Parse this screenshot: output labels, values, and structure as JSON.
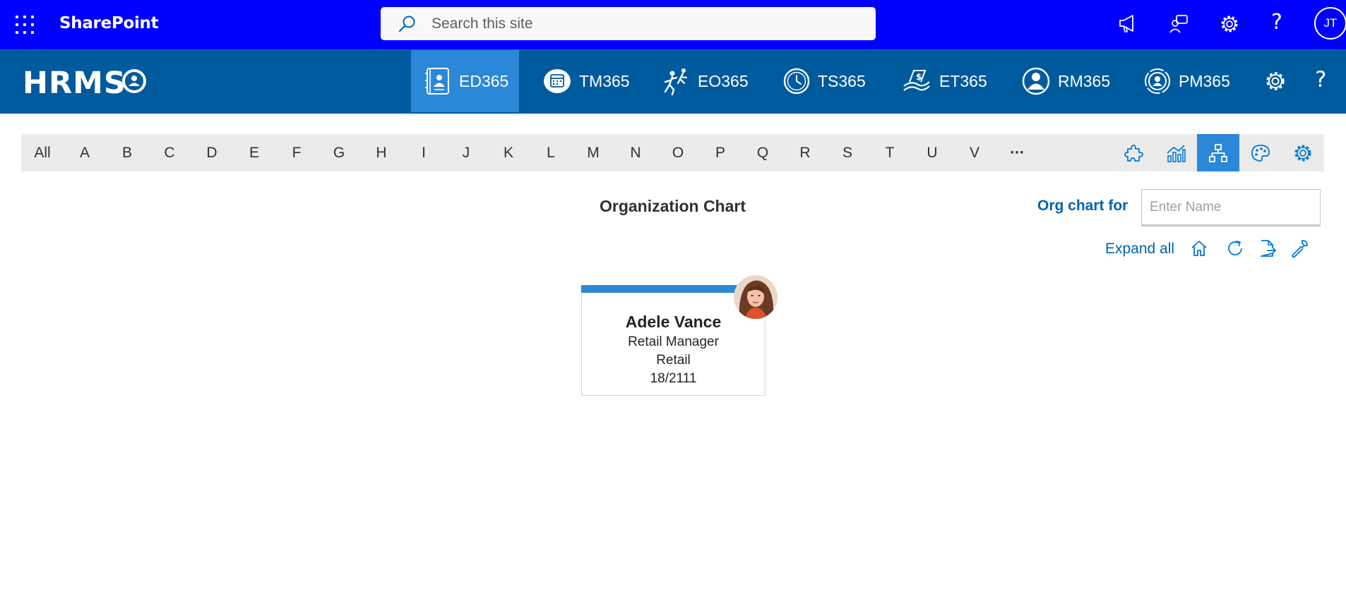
{
  "suitebar": {
    "app_name": "SharePoint",
    "search_placeholder": "Search this site",
    "user_initials": "JT",
    "icons": [
      "app-launcher-icon",
      "megaphone-icon",
      "feedback-icon",
      "gear-icon",
      "help-icon"
    ]
  },
  "hrms": {
    "logo_text": "HRMS",
    "tabs": [
      {
        "label": "ED365",
        "icon": "directory-icon",
        "active": true
      },
      {
        "label": "TM365",
        "icon": "calendar-icon",
        "active": false
      },
      {
        "label": "EO365",
        "icon": "onboarding-icon",
        "active": false
      },
      {
        "label": "TS365",
        "icon": "clock-icon",
        "active": false
      },
      {
        "label": "ET365",
        "icon": "expense-icon",
        "active": false
      },
      {
        "label": "RM365",
        "icon": "person-icon",
        "active": false
      },
      {
        "label": "PM365",
        "icon": "performance-icon",
        "active": false
      }
    ]
  },
  "alphabet": {
    "letters": [
      "All",
      "A",
      "B",
      "C",
      "D",
      "E",
      "F",
      "G",
      "H",
      "I",
      "J",
      "K",
      "L",
      "M",
      "N",
      "O",
      "P",
      "Q",
      "R",
      "S",
      "T",
      "U",
      "V"
    ],
    "more": "···",
    "tools": [
      "puzzle-icon",
      "chart-icon",
      "org-chart-icon",
      "palette-icon",
      "gear-icon"
    ],
    "active_tool": "org-chart-icon"
  },
  "orgchart": {
    "title": "Organization Chart",
    "for_label": "Org chart for",
    "name_placeholder": "Enter Name",
    "expand_all": "Expand all",
    "card": {
      "name": "Adele Vance",
      "title": "Retail Manager",
      "department": "Retail",
      "extension": "18/2111"
    }
  },
  "colors": {
    "suitebar": "#0000ff",
    "hrmsbar": "#005a9e",
    "accent": "#2b88d8",
    "link": "#0063b1"
  }
}
